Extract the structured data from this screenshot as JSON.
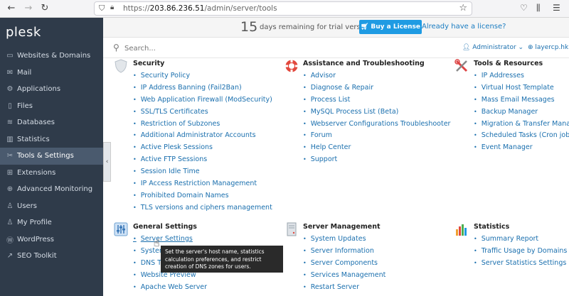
{
  "browser": {
    "url_prefix": "https://",
    "url_host": "203.86.236.51",
    "url_path": "/admin/server/tools"
  },
  "sidebar": {
    "logo": "plesk",
    "items": [
      {
        "label": "Websites & Domains",
        "icon": "monitor-icon"
      },
      {
        "label": "Mail",
        "icon": "mail-icon"
      },
      {
        "label": "Applications",
        "icon": "gear-icon"
      },
      {
        "label": "Files",
        "icon": "file-icon"
      },
      {
        "label": "Databases",
        "icon": "database-icon"
      },
      {
        "label": "Statistics",
        "icon": "chart-icon"
      },
      {
        "label": "Tools & Settings",
        "icon": "tools-icon",
        "active": true
      },
      {
        "label": "Extensions",
        "icon": "puzzle-icon"
      },
      {
        "label": "Advanced Monitoring",
        "icon": "monitoring-icon"
      },
      {
        "label": "Users",
        "icon": "user-icon"
      },
      {
        "label": "My Profile",
        "icon": "profile-icon"
      },
      {
        "label": "WordPress",
        "icon": "wordpress-icon"
      },
      {
        "label": "SEO Toolkit",
        "icon": "seo-icon"
      }
    ]
  },
  "trial": {
    "days": "15",
    "text": "days remaining for trial version",
    "buy_label": "Buy a License",
    "have_license": "Already have a license?"
  },
  "search": {
    "placeholder": "Search...",
    "user": "Administrator",
    "domain": "layercp.hk"
  },
  "sections": {
    "security": {
      "title": "Security",
      "links": [
        "Security Policy",
        "IP Address Banning (Fail2Ban)",
        "Web Application Firewall (ModSecurity)",
        "SSL/TLS Certificates",
        "Restriction of Subzones",
        "Additional Administrator Accounts",
        "Active Plesk Sessions",
        "Active FTP Sessions",
        "Session Idle Time",
        "IP Access Restriction Management",
        "Prohibited Domain Names",
        "TLS versions and ciphers management"
      ]
    },
    "assistance": {
      "title": "Assistance and Troubleshooting",
      "links": [
        "Advisor",
        "Diagnose & Repair",
        "Process List",
        "MySQL Process List (Beta)",
        "Webserver Configurations Troubleshooter",
        "Forum",
        "Help Center",
        "Support"
      ]
    },
    "tools": {
      "title": "Tools & Resources",
      "links": [
        "IP Addresses",
        "Virtual Host Template",
        "Mass Email Messages",
        "Backup Manager",
        "Migration & Transfer Manager",
        "Scheduled Tasks (Cron jobs)",
        "Event Manager"
      ]
    },
    "general": {
      "title": "General Settings",
      "links": [
        "Server Settings",
        "System",
        "DNS Te",
        "Website Preview",
        "Apache Web Server"
      ]
    },
    "server": {
      "title": "Server Management",
      "links": [
        "System Updates",
        "Server Information",
        "Server Components",
        "Services Management",
        "Restart Server"
      ]
    },
    "statistics": {
      "title": "Statistics",
      "links": [
        "Summary Report",
        "Traffic Usage by Domains",
        "Server Statistics Settings"
      ]
    }
  },
  "tooltip": "Set the server's host name, statistics calculation preferences, and restrict creation of DNS zones for users."
}
